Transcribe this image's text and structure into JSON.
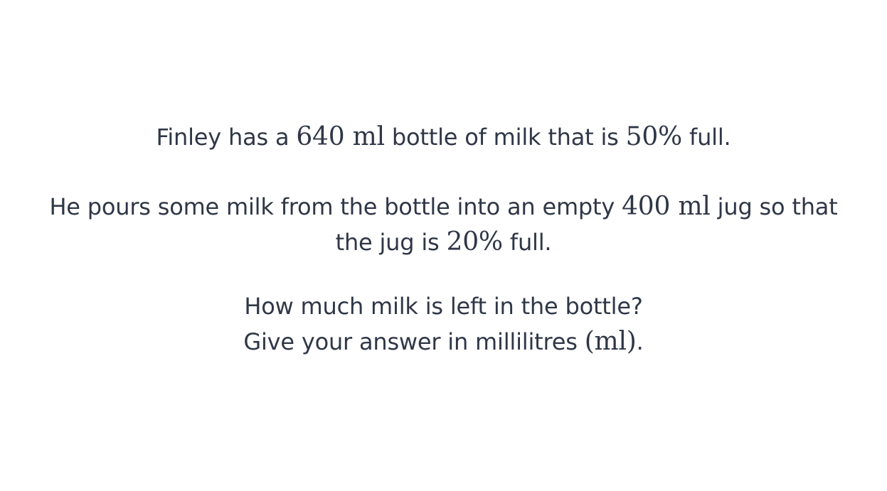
{
  "question": {
    "p1": {
      "t1": "Finley has a ",
      "m1": "640 ml",
      "t2": " bottle of milk that is ",
      "m2": "50%",
      "t3": " full."
    },
    "p2": {
      "t1": "He pours some milk from the bottle into an empty ",
      "m1": "400 ml",
      "t2": " jug so that the jug is ",
      "m2": "20%",
      "t3": " full."
    },
    "p3": {
      "line1": "How much milk is left in the bottle?",
      "t1": "Give your answer in millilitres ",
      "m1": "(ml)",
      "t2": "."
    }
  },
  "colors": {
    "text": "#2f3747",
    "background": "#ffffff"
  }
}
